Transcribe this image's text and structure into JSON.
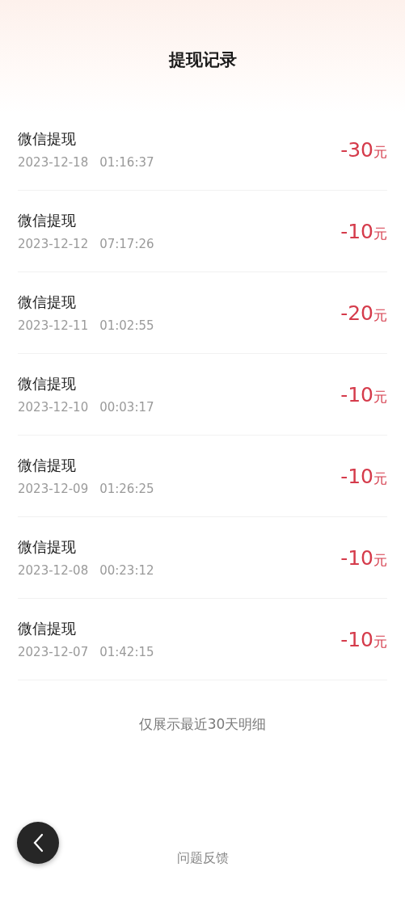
{
  "title": "提现记录",
  "records": [
    {
      "name": "微信提现",
      "date": "2023-12-18",
      "time": "01:16:37",
      "amount": "-30",
      "unit": "元"
    },
    {
      "name": "微信提现",
      "date": "2023-12-12",
      "time": "07:17:26",
      "amount": "-10",
      "unit": "元"
    },
    {
      "name": "微信提现",
      "date": "2023-12-11",
      "time": "01:02:55",
      "amount": "-20",
      "unit": "元"
    },
    {
      "name": "微信提现",
      "date": "2023-12-10",
      "time": "00:03:17",
      "amount": "-10",
      "unit": "元"
    },
    {
      "name": "微信提现",
      "date": "2023-12-09",
      "time": "01:26:25",
      "amount": "-10",
      "unit": "元"
    },
    {
      "name": "微信提现",
      "date": "2023-12-08",
      "time": "00:23:12",
      "amount": "-10",
      "unit": "元"
    },
    {
      "name": "微信提现",
      "date": "2023-12-07",
      "time": "01:42:15",
      "amount": "-10",
      "unit": "元"
    }
  ],
  "note": "仅展示最近30天明细",
  "feedback": "问题反馈"
}
